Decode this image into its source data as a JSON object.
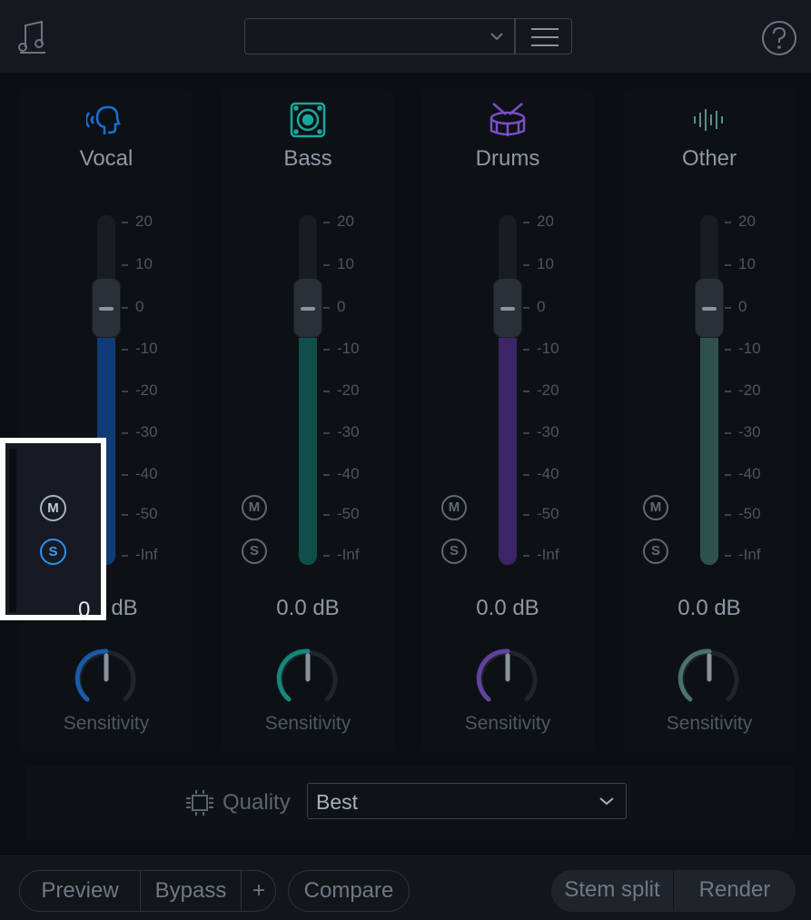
{
  "header": {
    "preset_value": "",
    "app_icon": "music-note-icon",
    "menu_icon": "hamburger-icon",
    "help_icon": "question-mark-icon"
  },
  "stems": [
    {
      "name": "Vocal",
      "icon": "vocal-head-icon",
      "db": "0.0 dB",
      "sensitivity_label": "Sensitivity",
      "color": "#1a6fd6",
      "fill_color": "#0f3c78",
      "fader_level_db": 0,
      "solo_active": true
    },
    {
      "name": "Bass",
      "icon": "speaker-icon",
      "db": "0.0 dB",
      "sensitivity_label": "Sensitivity",
      "color": "#17a89a",
      "fill_color": "#0f4e4a",
      "fader_level_db": 0,
      "solo_active": false
    },
    {
      "name": "Drums",
      "icon": "drum-icon",
      "db": "0.0 dB",
      "sensitivity_label": "Sensitivity",
      "color": "#7a4fc7",
      "fill_color": "#3c2566",
      "fader_level_db": 0,
      "solo_active": false
    },
    {
      "name": "Other",
      "icon": "waveform-icon",
      "db": "0.0 dB",
      "sensitivity_label": "Sensitivity",
      "color": "#5a8f84",
      "fill_color": "#2f514c",
      "fader_level_db": 0,
      "solo_active": false
    }
  ],
  "scale_ticks": [
    "20",
    "10",
    "0",
    "-10",
    "-20",
    "-30",
    "-40",
    "-50",
    "-Inf"
  ],
  "mute_label": "M",
  "solo_label": "S",
  "highlight_zero": "0",
  "quality": {
    "label": "Quality",
    "value": "Best",
    "icon": "chip-icon"
  },
  "footer": {
    "preview": "Preview",
    "bypass": "Bypass",
    "plus": "+",
    "compare": "Compare",
    "stem_split": "Stem split",
    "render": "Render"
  }
}
